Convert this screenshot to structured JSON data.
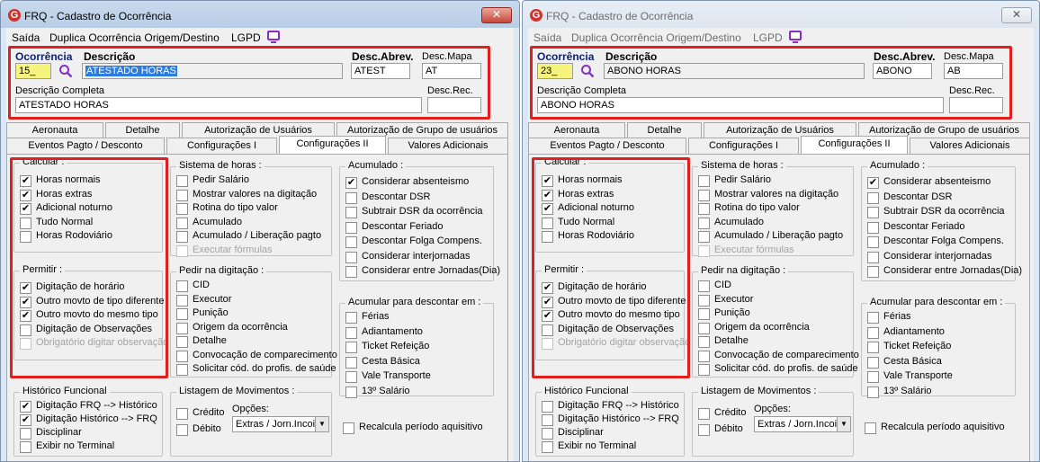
{
  "windows": [
    {
      "title": "FRQ - Cadastro de Ocorrência",
      "close_label": "✕",
      "menu": {
        "saida": "Saída",
        "duplica": "Duplica Ocorrência Origem/Destino",
        "lgpd": "LGPD"
      },
      "header": {
        "ocorrencia_label": "Ocorrência",
        "ocorrencia_value": "15_",
        "descricao_label": "Descrição",
        "descricao_value": "ATESTADO HORAS",
        "desc_abrev_label": "Desc.Abrev.",
        "desc_abrev_value": "ATEST",
        "desc_mapa_label": "Desc.Mapa",
        "desc_mapa_value": "AT",
        "desc_completa_label": "Descrição Completa",
        "desc_completa_value": "ATESTADO HORAS",
        "desc_rec_label": "Desc.Rec.",
        "desc_rec_value": ""
      },
      "tabs_row1": [
        "Aeronauta",
        "Detalhe",
        "Autorização de Usuários",
        "Autorização de Grupo de usuários"
      ],
      "tabs_row2": [
        "Eventos Pagto / Desconto",
        "Configurações I",
        "Configurações II",
        "Valores Adicionais"
      ],
      "active_tab": "Configurações II",
      "groups": {
        "calcular": {
          "title": "Calcular :",
          "items": [
            {
              "label": "Horas normais",
              "checked": true,
              "disabled": false
            },
            {
              "label": "Horas extras",
              "checked": true,
              "disabled": false
            },
            {
              "label": "Adicional noturno",
              "checked": true,
              "disabled": false
            },
            {
              "label": "Tudo Normal",
              "checked": false,
              "disabled": false
            },
            {
              "label": "Horas Rodoviário",
              "checked": false,
              "disabled": false
            }
          ]
        },
        "permitir": {
          "title": "Permitir :",
          "items": [
            {
              "label": "Digitação de horário",
              "checked": true,
              "disabled": false
            },
            {
              "label": "Outro movto de tipo diferente",
              "checked": true,
              "disabled": false
            },
            {
              "label": "Outro movto do mesmo tipo",
              "checked": true,
              "disabled": false
            },
            {
              "label": "Digitação de Observações",
              "checked": false,
              "disabled": false
            },
            {
              "label": "Obrigatório digitar observação",
              "checked": false,
              "disabled": true
            }
          ]
        },
        "historico": {
          "title": "Histórico Funcional",
          "items": [
            {
              "label": "Digitação FRQ --> Histórico",
              "checked": true,
              "disabled": false
            },
            {
              "label": "Digitação Histórico --> FRQ",
              "checked": true,
              "disabled": false
            },
            {
              "label": "Disciplinar",
              "checked": false,
              "disabled": false
            },
            {
              "label": "Exibir no Terminal",
              "checked": false,
              "disabled": false
            }
          ]
        },
        "sistema": {
          "title": "Sistema de horas :",
          "items": [
            {
              "label": "Pedir Salário",
              "checked": false,
              "disabled": false
            },
            {
              "label": "Mostrar valores na digitação",
              "checked": false,
              "disabled": false
            },
            {
              "label": "Rotina do tipo valor",
              "checked": false,
              "disabled": false
            },
            {
              "label": "Acumulado",
              "checked": false,
              "disabled": false
            },
            {
              "label": "Acumulado / Liberação pagto",
              "checked": false,
              "disabled": false
            },
            {
              "label": "Executar fórmulas",
              "checked": false,
              "disabled": true
            }
          ]
        },
        "pedir": {
          "title": "Pedir na digitação :",
          "items": [
            {
              "label": "CID",
              "checked": false,
              "disabled": false
            },
            {
              "label": "Executor",
              "checked": false,
              "disabled": false
            },
            {
              "label": "Punição",
              "checked": false,
              "disabled": false
            },
            {
              "label": "Origem da ocorrência",
              "checked": false,
              "disabled": false
            },
            {
              "label": "Detalhe",
              "checked": false,
              "disabled": false
            },
            {
              "label": "Convocação de comparecimento",
              "checked": false,
              "disabled": false
            },
            {
              "label": "Solicitar cód. do profis. de saúde",
              "checked": false,
              "disabled": false
            }
          ]
        },
        "listagem": {
          "title": "Listagem de Movimentos :",
          "credito": "Crédito",
          "debito": "Débito",
          "opcoes_label": "Opções:",
          "opcoes_value": "Extras / Jorn.Incoi",
          "credito_checked": false,
          "debito_checked": false
        },
        "acumulado": {
          "title": "Acumulado :",
          "items": [
            {
              "label": "Considerar absenteismo",
              "checked": true,
              "disabled": false
            },
            {
              "label": "Descontar DSR",
              "checked": false,
              "disabled": false
            },
            {
              "label": "Subtrair DSR da ocorrência",
              "checked": false,
              "disabled": false
            },
            {
              "label": "Descontar Feriado",
              "checked": false,
              "disabled": false
            },
            {
              "label": "Descontar Folga Compens.",
              "checked": false,
              "disabled": false
            },
            {
              "label": "Considerar interjornadas",
              "checked": false,
              "disabled": false
            },
            {
              "label": "Considerar entre Jornadas(Dia)",
              "checked": false,
              "disabled": false
            }
          ]
        },
        "acumular": {
          "title": "Acumular para descontar em :",
          "items": [
            {
              "label": "Férias",
              "checked": false,
              "disabled": false
            },
            {
              "label": "Adiantamento",
              "checked": false,
              "disabled": false
            },
            {
              "label": "Ticket Refeição",
              "checked": false,
              "disabled": false
            },
            {
              "label": "Cesta Básica",
              "checked": false,
              "disabled": false
            },
            {
              "label": "Vale Transporte",
              "checked": false,
              "disabled": false
            },
            {
              "label": "13º Salário",
              "checked": false,
              "disabled": false
            }
          ]
        },
        "recalcula": {
          "label": "Recalcula período aquisitivo",
          "checked": false
        }
      }
    },
    {
      "title": "FRQ - Cadastro de Ocorrência",
      "close_label": "✕",
      "menu": {
        "saida": "Saída",
        "duplica": "Duplica Ocorrência Origem/Destino",
        "lgpd": "LGPD"
      },
      "header": {
        "ocorrencia_label": "Ocorrência",
        "ocorrencia_value": "23_",
        "descricao_label": "Descrição",
        "descricao_value": "ABONO HORAS",
        "desc_abrev_label": "Desc.Abrev.",
        "desc_abrev_value": "ABONO",
        "desc_mapa_label": "Desc.Mapa",
        "desc_mapa_value": "AB",
        "desc_completa_label": "Descrição Completa",
        "desc_completa_value": "ABONO HORAS",
        "desc_rec_label": "Desc.Rec.",
        "desc_rec_value": ""
      },
      "tabs_row1": [
        "Aeronauta",
        "Detalhe",
        "Autorização de Usuários",
        "Autorização de Grupo de usuários"
      ],
      "tabs_row2": [
        "Eventos Pagto / Desconto",
        "Configurações I",
        "Configurações II",
        "Valores Adicionais"
      ],
      "active_tab": "Configurações II",
      "groups": {
        "calcular": {
          "title": "Calcular :",
          "items": [
            {
              "label": "Horas normais",
              "checked": true,
              "disabled": false
            },
            {
              "label": "Horas extras",
              "checked": true,
              "disabled": false
            },
            {
              "label": "Adicional noturno",
              "checked": true,
              "disabled": false
            },
            {
              "label": "Tudo Normal",
              "checked": false,
              "disabled": false
            },
            {
              "label": "Horas Rodoviário",
              "checked": false,
              "disabled": false
            }
          ]
        },
        "permitir": {
          "title": "Permitir :",
          "items": [
            {
              "label": "Digitação de horário",
              "checked": true,
              "disabled": false
            },
            {
              "label": "Outro movto de tipo diferente",
              "checked": true,
              "disabled": false
            },
            {
              "label": "Outro movto do mesmo tipo",
              "checked": true,
              "disabled": false
            },
            {
              "label": "Digitação de Observações",
              "checked": false,
              "disabled": false
            },
            {
              "label": "Obrigatório digitar observação",
              "checked": false,
              "disabled": true
            }
          ]
        },
        "historico": {
          "title": "Histórico Funcional",
          "items": [
            {
              "label": "Digitação FRQ --> Histórico",
              "checked": false,
              "disabled": false
            },
            {
              "label": "Digitação Histórico --> FRQ",
              "checked": false,
              "disabled": false
            },
            {
              "label": "Disciplinar",
              "checked": false,
              "disabled": false
            },
            {
              "label": "Exibir no Terminal",
              "checked": false,
              "disabled": false
            }
          ]
        },
        "sistema": {
          "title": "Sistema de horas :",
          "items": [
            {
              "label": "Pedir Salário",
              "checked": false,
              "disabled": false
            },
            {
              "label": "Mostrar valores na digitação",
              "checked": false,
              "disabled": false
            },
            {
              "label": "Rotina do tipo valor",
              "checked": false,
              "disabled": false
            },
            {
              "label": "Acumulado",
              "checked": false,
              "disabled": false
            },
            {
              "label": "Acumulado / Liberação pagto",
              "checked": false,
              "disabled": false
            },
            {
              "label": "Executar fórmulas",
              "checked": false,
              "disabled": true
            }
          ]
        },
        "pedir": {
          "title": "Pedir na digitação :",
          "items": [
            {
              "label": "CID",
              "checked": false,
              "disabled": false
            },
            {
              "label": "Executor",
              "checked": false,
              "disabled": false
            },
            {
              "label": "Punição",
              "checked": false,
              "disabled": false
            },
            {
              "label": "Origem da ocorrência",
              "checked": false,
              "disabled": false
            },
            {
              "label": "Detalhe",
              "checked": false,
              "disabled": false
            },
            {
              "label": "Convocação de comparecimento",
              "checked": false,
              "disabled": false
            },
            {
              "label": "Solicitar cód. do profis. de saúde",
              "checked": false,
              "disabled": false
            }
          ]
        },
        "listagem": {
          "title": "Listagem de Movimentos :",
          "credito": "Crédito",
          "debito": "Débito",
          "opcoes_label": "Opções:",
          "opcoes_value": "Extras / Jorn.Incoi",
          "credito_checked": false,
          "debito_checked": false
        },
        "acumulado": {
          "title": "Acumulado :",
          "items": [
            {
              "label": "Considerar absenteismo",
              "checked": true,
              "disabled": false
            },
            {
              "label": "Descontar DSR",
              "checked": false,
              "disabled": false
            },
            {
              "label": "Subtrair DSR da ocorrência",
              "checked": false,
              "disabled": false
            },
            {
              "label": "Descontar Feriado",
              "checked": false,
              "disabled": false
            },
            {
              "label": "Descontar Folga Compens.",
              "checked": false,
              "disabled": false
            },
            {
              "label": "Considerar interjornadas",
              "checked": false,
              "disabled": false
            },
            {
              "label": "Considerar entre Jornadas(Dia)",
              "checked": false,
              "disabled": false
            }
          ]
        },
        "acumular": {
          "title": "Acumular para descontar em :",
          "items": [
            {
              "label": "Férias",
              "checked": false,
              "disabled": false
            },
            {
              "label": "Adiantamento",
              "checked": false,
              "disabled": false
            },
            {
              "label": "Ticket Refeição",
              "checked": false,
              "disabled": false
            },
            {
              "label": "Cesta Básica",
              "checked": false,
              "disabled": false
            },
            {
              "label": "Vale Transporte",
              "checked": false,
              "disabled": false
            },
            {
              "label": "13º Salário",
              "checked": false,
              "disabled": false
            }
          ]
        },
        "recalcula": {
          "label": "Recalcula período aquisitivo",
          "checked": false
        }
      }
    }
  ],
  "colors": {
    "highlight_box": "#e02020",
    "required_field": "#f7f47d",
    "label_blue": "#0a1e7a",
    "selection": "#2c7be0",
    "lgpd_icon": "#8a2ec9"
  }
}
